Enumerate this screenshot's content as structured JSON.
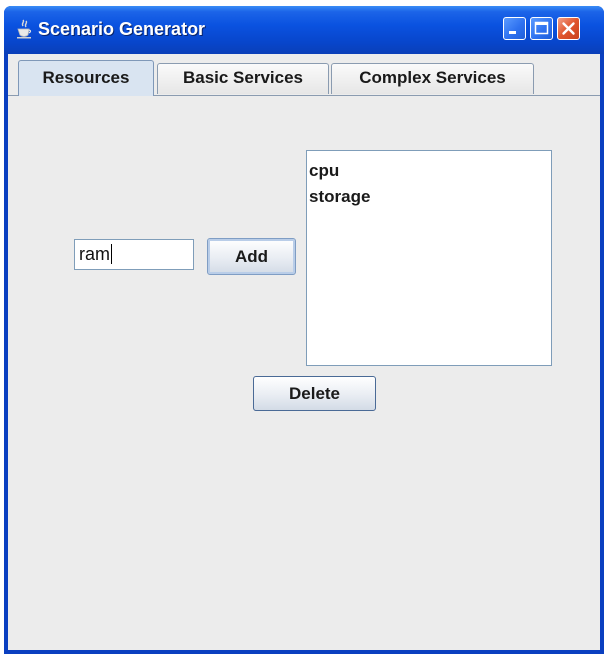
{
  "window": {
    "title": "Scenario Generator",
    "app_icon": "java-cup-icon",
    "controls": [
      "minimize-icon",
      "maximize-icon",
      "close-icon"
    ]
  },
  "tabs": [
    {
      "label": "Resources",
      "active": true
    },
    {
      "label": "Basic Services",
      "active": false
    },
    {
      "label": "Complex Services",
      "active": false
    }
  ],
  "resources": {
    "input_value": "ram",
    "add_label": "Add",
    "delete_label": "Delete",
    "items": [
      "cpu",
      "storage"
    ]
  },
  "colors": {
    "titlebar": "#0a52e0",
    "close_button": "#e0552c",
    "panel_bg": "#ececec",
    "active_tab": "#d9e4f1"
  }
}
